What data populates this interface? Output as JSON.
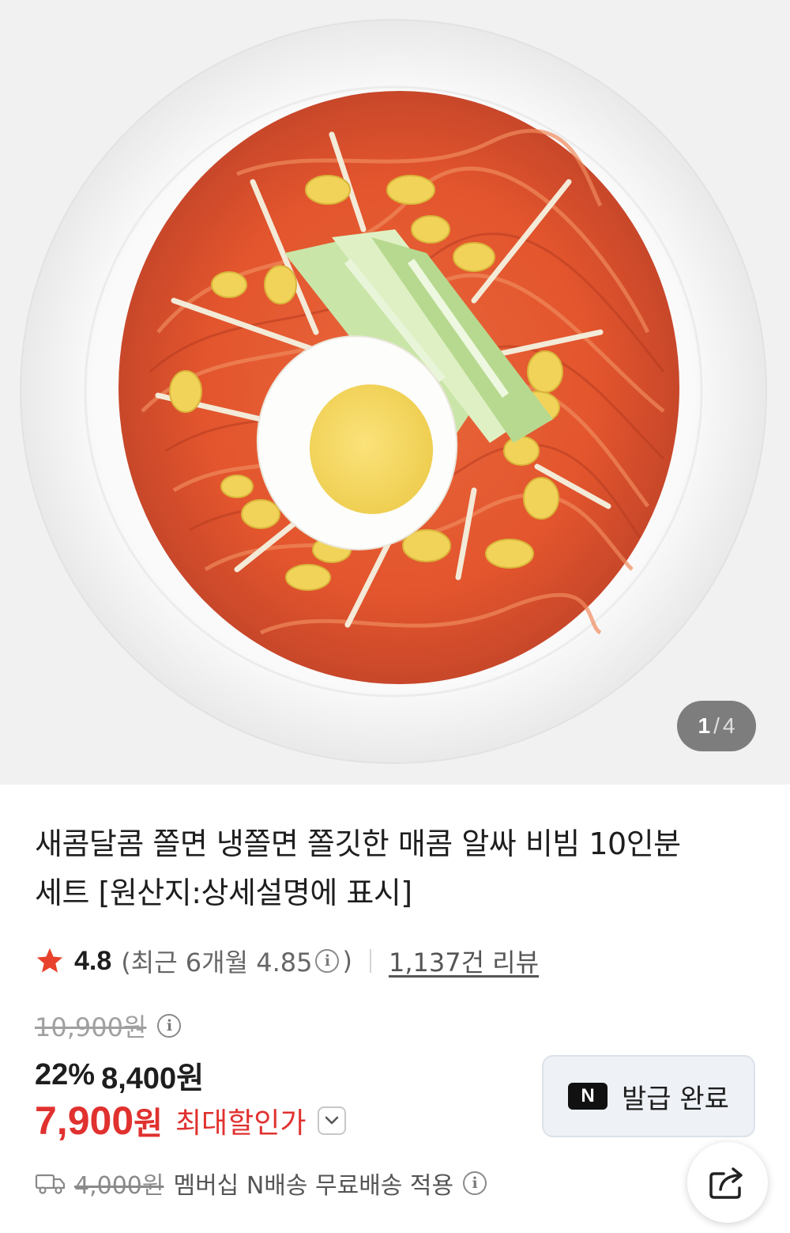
{
  "gallery": {
    "current": "1",
    "separator": "/",
    "total": "4"
  },
  "product": {
    "title_line1": "새콤달콤 쫄면 냉쫄면 쫄깃한 매콤 알싸 비빔 10인분",
    "title_line2": "세트 [원산지:상세설명에 표시]"
  },
  "rating": {
    "score": "4.8",
    "recent_prefix": "(최근 6개월 4.85",
    "recent_suffix": ")",
    "reviews": "1,137건 리뷰",
    "info_glyph": "i"
  },
  "price": {
    "original": "10,900원",
    "discount_percent": "22%",
    "discounted": "8,400원",
    "final_number": "7,900",
    "final_unit": "원",
    "final_label": "최대할인가",
    "info_glyph": "i"
  },
  "coupon": {
    "logo": "N",
    "label": "발급 완료"
  },
  "shipping": {
    "old_fee": "4,000원",
    "message": "멤버십 N배송 무료배송 적용",
    "info_glyph": "i"
  },
  "colors": {
    "accent_red": "#e0312f",
    "star": "#e8412c"
  },
  "icons": {
    "star": "star-icon",
    "chevron": "chevron-down-icon",
    "truck": "truck-icon",
    "share": "share-icon"
  }
}
